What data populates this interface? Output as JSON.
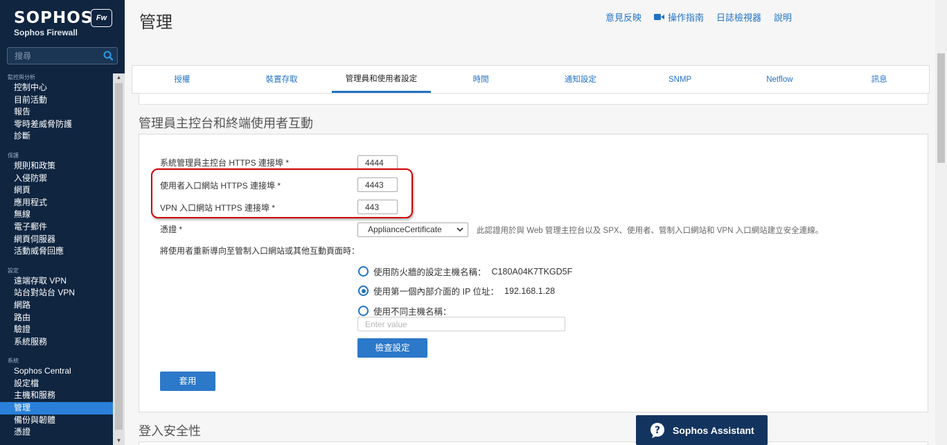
{
  "sidebar": {
    "brand_name": "SOPHOS",
    "brand_sub": "Sophos Firewall",
    "badge": "Fw",
    "search_placeholder": "搜尋",
    "groups": [
      {
        "head": "監控與分析",
        "items": [
          "控制中心",
          "目前活動",
          "報告",
          "零時差威脅防護",
          "診斷"
        ]
      },
      {
        "head": "保護",
        "items": [
          "規則和政策",
          "入侵防禦",
          "網頁",
          "應用程式",
          "無線",
          "電子郵件",
          "網頁伺服器",
          "活動威脅回應"
        ]
      },
      {
        "head": "設定",
        "items": [
          "遠端存取 VPN",
          "站台對站台 VPN",
          "網路",
          "路由",
          "驗證",
          "系統服務"
        ]
      },
      {
        "head": "系統",
        "items": [
          "Sophos Central",
          "設定檔",
          "主機和服務",
          "管理",
          "備份與韌體",
          "憑證"
        ]
      }
    ],
    "active_item": "管理"
  },
  "header": {
    "title": "管理",
    "links": [
      "意見反映",
      "操作指南",
      "日誌檢視器",
      "說明"
    ]
  },
  "tabs": [
    "授權",
    "裝置存取",
    "管理員和使用者設定",
    "時間",
    "通知設定",
    "SNMP",
    "Netflow",
    "訊息"
  ],
  "active_tab": "管理員和使用者設定",
  "section1": {
    "title": "管理員主控台和終端使用者互動",
    "admin_https_label": "系統管理員主控台 HTTPS 連接埠 *",
    "admin_https_port": "4444",
    "user_portal_label": "使用者入口網站 HTTPS 連接埠 *",
    "user_portal_port": "4443",
    "vpn_portal_label": "VPN 入口網站 HTTPS 連接埠 *",
    "vpn_portal_port": "443",
    "cert_label": "憑證 *",
    "cert_value": "ApplianceCertificate",
    "cert_hint": "此認證用於與 Web 管理主控台以及 SPX、使用者、管制入口網站和 VPN 入口網站建立安全連線。",
    "redirect_label": "將使用者重新導向至管制入口網站或其他互動頁面時：",
    "radio_options": [
      {
        "label": "使用防火牆的設定主機名稱：",
        "value": "C180A04K7TKGD5F",
        "checked": false
      },
      {
        "label": "使用第一個內部介面的 IP 位址：",
        "value": "192.168.1.28",
        "checked": true
      },
      {
        "label": "使用不同主機名稱：",
        "value": "",
        "checked": false
      }
    ],
    "host_placeholder": "Enter value",
    "check_button": "檢查設定",
    "apply_button": "套用"
  },
  "section2": {
    "title": "登入安全性"
  },
  "assistant": {
    "label": "Sophos Assistant"
  },
  "colors": {
    "sidebar_bg": "#0f2540",
    "accent": "#2273c4",
    "highlight": "#d00000",
    "assistant_bg": "#13345f"
  }
}
